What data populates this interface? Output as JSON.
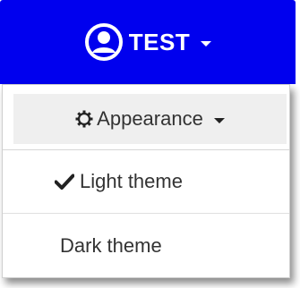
{
  "header": {
    "user_name": "TEST",
    "colors": {
      "background": "#0000ee",
      "text": "#ffffff"
    },
    "icons": {
      "avatar": "user-circle-icon",
      "caret": "caret-down-icon"
    }
  },
  "appearance_menu": {
    "label": "Appearance",
    "icons": {
      "gear": "gear-icon",
      "caret": "caret-down-icon"
    }
  },
  "theme_options": [
    {
      "label": "Light theme",
      "selected": true,
      "icon": "check-icon"
    },
    {
      "label": "Dark theme",
      "selected": false
    }
  ]
}
